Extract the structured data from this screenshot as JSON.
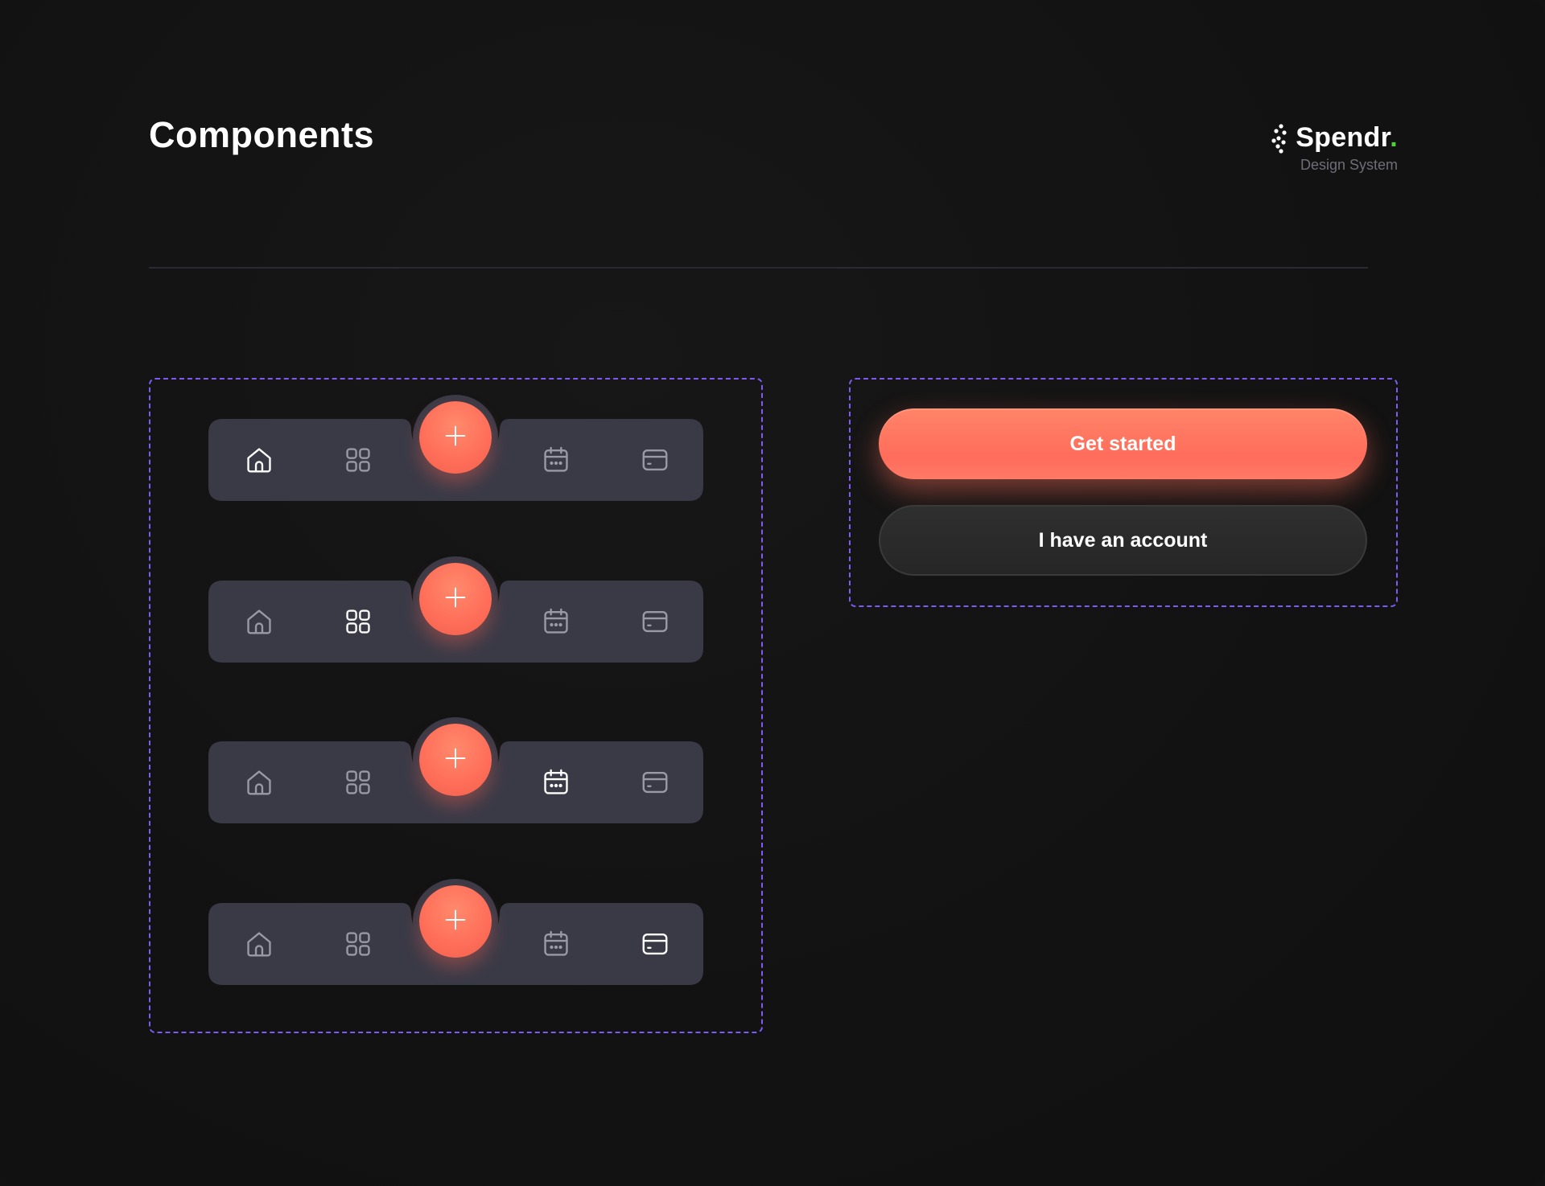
{
  "header": {
    "title": "Components"
  },
  "brand": {
    "name": "Spendr",
    "dot": ".",
    "subtitle": "Design System",
    "accent_color": "#4fd13a"
  },
  "colors": {
    "background": "#121212",
    "frame_border": "#7b5cf5",
    "navbar_bg": "#3a3a47",
    "icon_inactive": "#9a9aa6",
    "icon_active": "#ffffff",
    "fab": "#ff6f5a",
    "primary_button": "#ff7460",
    "secondary_button": "#2a2a2a"
  },
  "navbar_variants": [
    {
      "active": "home"
    },
    {
      "active": "grid"
    },
    {
      "active": "calendar"
    },
    {
      "active": "card"
    }
  ],
  "navbar_items": [
    {
      "id": "home",
      "icon": "home-icon"
    },
    {
      "id": "grid",
      "icon": "grid-icon"
    },
    {
      "id": "add",
      "icon": "plus-icon"
    },
    {
      "id": "calendar",
      "icon": "calendar-icon"
    },
    {
      "id": "card",
      "icon": "card-icon"
    }
  ],
  "buttons": {
    "primary_label": "Get started",
    "secondary_label": "I have an account"
  }
}
